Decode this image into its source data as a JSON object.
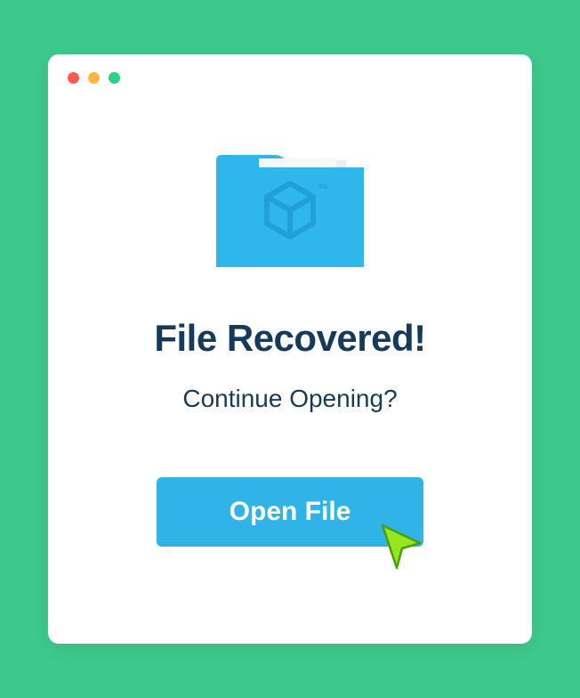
{
  "dialog": {
    "heading": "File Recovered!",
    "subheading": "Continue Opening?",
    "button_label": "Open File"
  }
}
